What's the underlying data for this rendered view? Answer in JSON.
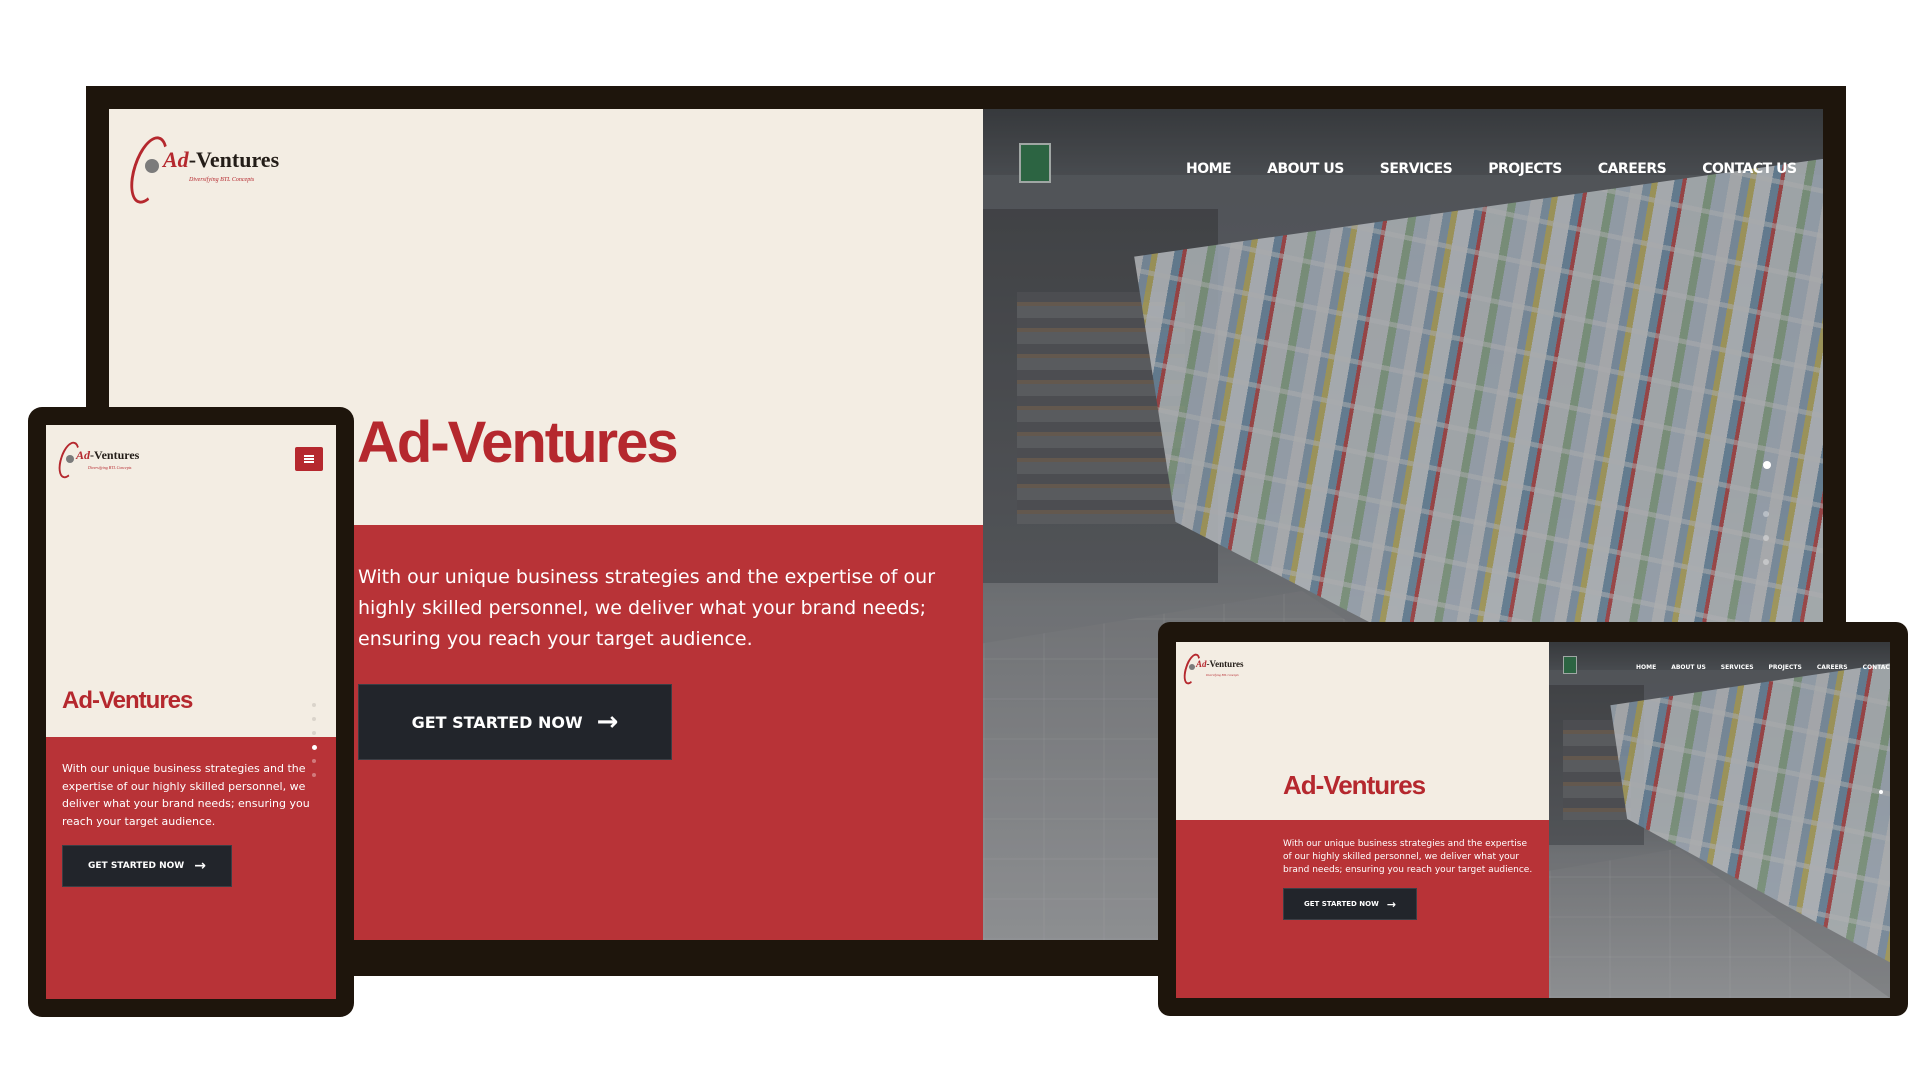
{
  "colors": {
    "brand_red": "#b5282e",
    "red_panel": "#b83337",
    "cream": "#f3ede3",
    "dark_button": "#22252b",
    "device_frame": "#1e150c"
  },
  "site": {
    "logo_ad": "Ad",
    "logo_rest": "-Ventures",
    "logo_tagline": "Diversifying BTL Concepts",
    "hero_title": "Ad-Ventures",
    "hero_text": "With our unique business strategies and the expertise of our highly skilled personnel, we deliver what your brand needs; ensuring you reach your target audience.",
    "cta_label": "GET STARTED NOW",
    "cta_icon": "arrow-right-icon",
    "menu_icon": "hamburger-icon",
    "nav": [
      "HOME",
      "ABOUT US",
      "SERVICES",
      "PROJECTS",
      "CAREERS",
      "CONTACT US"
    ]
  }
}
